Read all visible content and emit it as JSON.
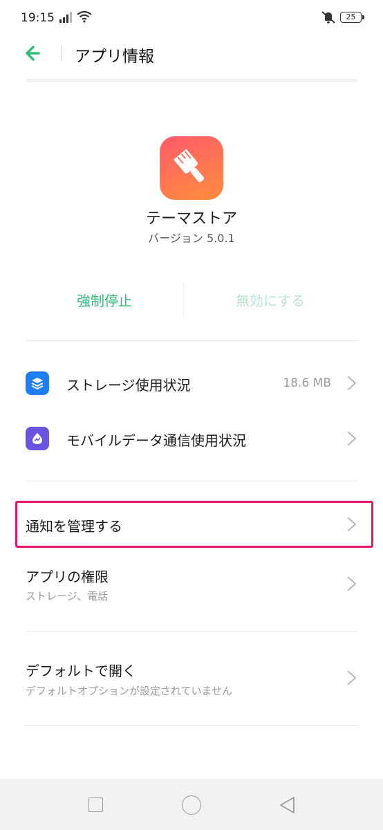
{
  "status_bar": {
    "time": "19:15",
    "battery": "25"
  },
  "header": {
    "title": "アプリ情報"
  },
  "app": {
    "name": "テーマストア",
    "version": "バージョン 5.0.1"
  },
  "actions": {
    "force_stop": "強制停止",
    "disable": "無効にする"
  },
  "colors": {
    "accent": "#2dbd78",
    "accent_disabled": "#b9e5cf",
    "highlight": "#e8176a",
    "storage_icon": "#1f7ef0",
    "data_icon": "#6a53e0"
  },
  "rows": {
    "storage": {
      "label": "ストレージ使用状況",
      "value": "18.6 MB",
      "icon": "layers-icon"
    },
    "mobile_data": {
      "label": "モバイルデータ通信使用状況",
      "icon": "data-usage-icon"
    },
    "notifications": {
      "label": "通知を管理する"
    },
    "permissions": {
      "label": "アプリの権限",
      "sub": "ストレージ、電話"
    },
    "default_open": {
      "label": "デフォルトで開く",
      "sub": "デフォルトオプションが設定されていません"
    }
  }
}
